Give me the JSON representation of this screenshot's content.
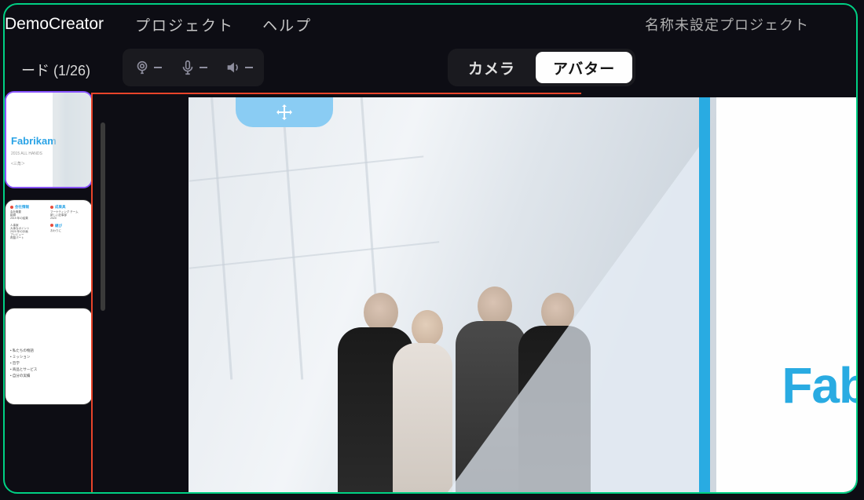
{
  "header": {
    "app_title": "DemoCreator",
    "menu": {
      "project": "プロジェクト",
      "help": "ヘルプ"
    },
    "project_name": "名称未設定プロジェクト"
  },
  "sidebar": {
    "header": "ード (1/26)",
    "thumbs": [
      {
        "title": "Fabrikam",
        "line1": "2015 ALL HANDS",
        "line2": "<三角＞"
      },
      {
        "col1": [
          {
            "heading": "会社情報",
            "text": "会社概要\n組織\n2019 年の結果"
          },
          {
            "heading": "",
            "text": "人事案\n大事なポイント\n2020 年の計画\nプレビュー\n再替パート"
          }
        ],
        "col2": [
          {
            "heading": "成果具",
            "text": "マーケティング チーム\n新しい記事部\n2020"
          },
          {
            "heading": "継び",
            "text": "おわりに"
          }
        ]
      },
      {
        "items": [
          "• 私たちの物語",
          "• ミッション",
          "• 哲学",
          "• 商品とサービス",
          "• 自分の実績"
        ]
      }
    ]
  },
  "toolbar": {
    "tabs": {
      "camera": "カメラ",
      "avatar": "アバター"
    }
  },
  "canvas": {
    "brand_text": "Fabr"
  },
  "colors": {
    "accent_blue": "#29abe2",
    "accent_purple": "#8854ff",
    "highlight_red": "#e8442a"
  }
}
